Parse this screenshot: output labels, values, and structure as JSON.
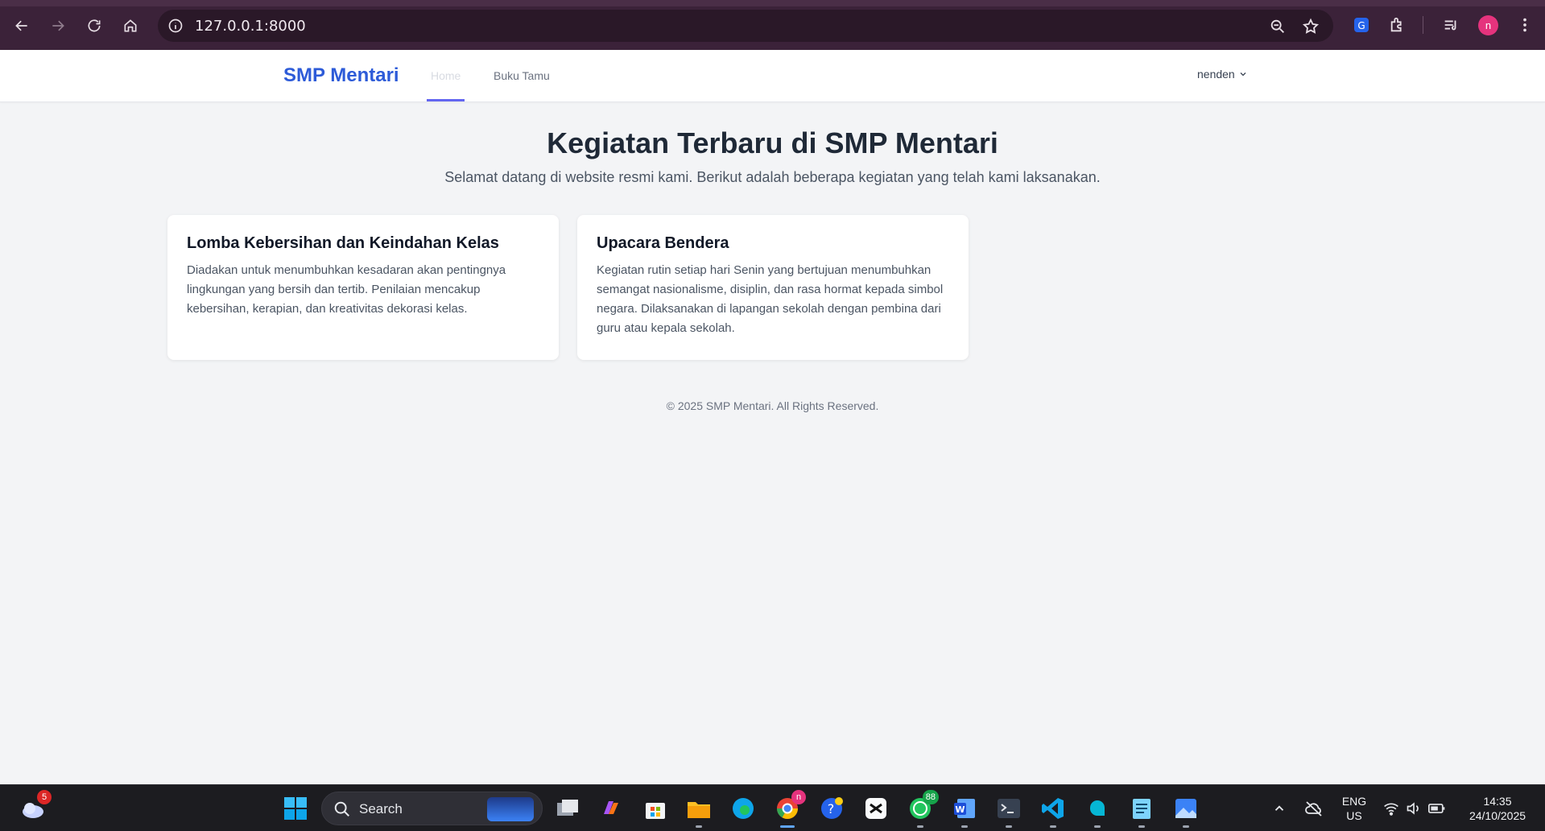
{
  "browser": {
    "url": "127.0.0.1:8000",
    "profile_initial": "n",
    "colors": {
      "frame": "#3b2239",
      "omnibox": "#2a1828",
      "profile": "#e5337d"
    }
  },
  "app": {
    "brand": "SMP Mentari",
    "nav": [
      {
        "label": "Home",
        "active": true
      },
      {
        "label": "Buku Tamu",
        "active": false
      }
    ],
    "user": "nenden",
    "colors": {
      "brand": "#2d5bd8",
      "underline": "#6366f1"
    }
  },
  "main": {
    "title": "Kegiatan Terbaru di SMP Mentari",
    "subtitle": "Selamat datang di website resmi kami. Berikut adalah beberapa kegiatan yang telah kami laksanakan.",
    "cards": [
      {
        "title": "Lomba Kebersihan dan Keindahan Kelas",
        "description": "Diadakan untuk menumbuhkan kesadaran akan pentingnya lingkungan yang bersih dan tertib. Penilaian mencakup kebersihan, kerapian, dan kreativitas dekorasi kelas."
      },
      {
        "title": "Upacara Bendera",
        "description": "Kegiatan rutin setiap hari Senin yang bertujuan menumbuhkan semangat nasionalisme, disiplin, dan rasa hormat kepada simbol negara. Dilaksanakan di lapangan sekolah dengan pembina dari guru atau kepala sekolah."
      }
    ],
    "footer": "© 2025 SMP Mentari. All Rights Reserved."
  },
  "taskbar": {
    "weather_badge": "5",
    "search_label": "Search",
    "whatsapp_badge": "88",
    "chrome_badge": "n",
    "language": "ENG",
    "region": "US",
    "time": "14:35",
    "date": "24/10/2025"
  }
}
